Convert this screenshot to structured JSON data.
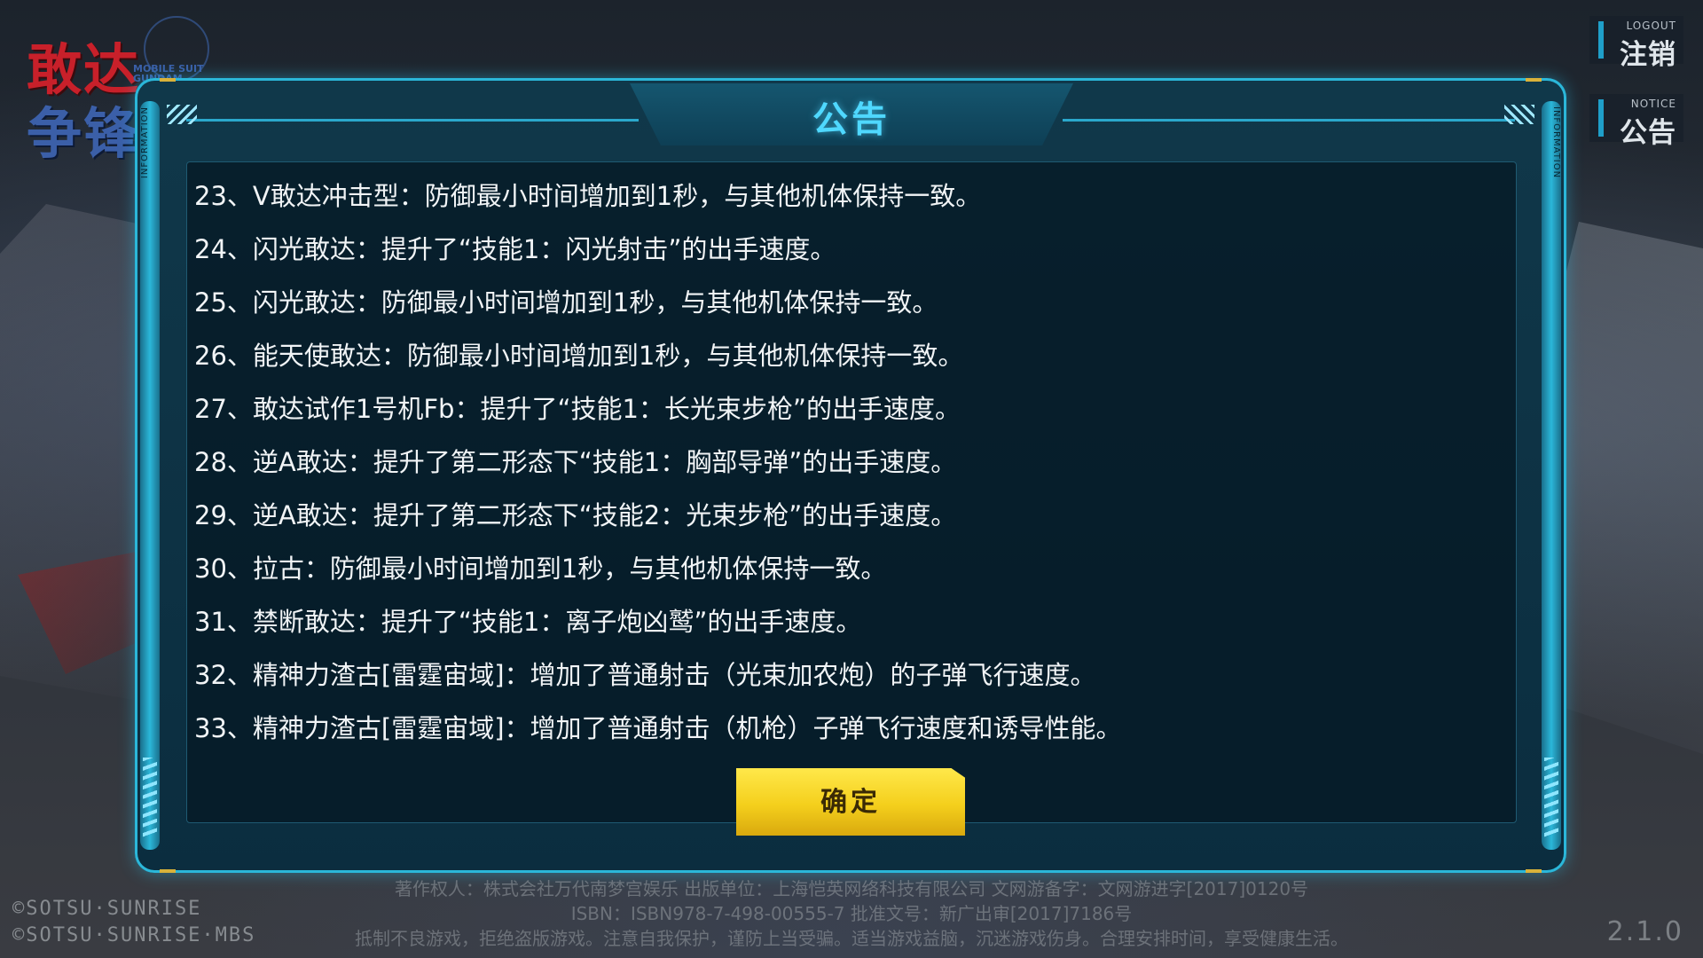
{
  "game_logo": {
    "line1": "敢达",
    "line2": "争锋",
    "subtitle": "MOBILE SUIT GUNDAM"
  },
  "side_nav": {
    "logout": {
      "en": "LOGOUT",
      "zh": "注销"
    },
    "notice": {
      "en": "NOTICE",
      "zh": "公告"
    }
  },
  "panel": {
    "title": "公告",
    "rail_label": "INFORMATION",
    "lines": [
      "23、V敢达冲击型：防御最小时间增加到1秒，与其他机体保持一致。",
      "24、闪光敢达：提升了“技能1：闪光射击”的出手速度。",
      "25、闪光敢达：防御最小时间增加到1秒，与其他机体保持一致。",
      "26、能天使敢达：防御最小时间增加到1秒，与其他机体保持一致。",
      "27、敢达试作1号机Fb：提升了“技能1：长光束步枪”的出手速度。",
      "28、逆A敢达：提升了第二形态下“技能1：胸部导弹”的出手速度。",
      "29、逆A敢达：提升了第二形态下“技能2：光束步枪”的出手速度。",
      "30、拉古：防御最小时间增加到1秒，与其他机体保持一致。",
      "31、禁断敢达：提升了“技能1：离子炮凶鹫”的出手速度。",
      "32、精神力渣古[雷霆宙域]：增加了普通射击（光束加农炮）的子弹飞行速度。",
      "33、精神力渣古[雷霆宙域]：增加了普通射击（机枪）子弹飞行速度和诱导性能。"
    ],
    "confirm_label": "确定"
  },
  "footer": {
    "line1": "著作权人：株式会社万代南梦宫娱乐  出版单位：上海恺英网络科技有限公司  文网游备字：文网游进字[2017]0120号",
    "line2": "ISBN：ISBN978-7-498-00555-7  批准文号：新广出审[2017]7186号",
    "line3": "抵制不良游戏，拒绝盗版游戏。注意自我保护，谨防上当受骗。适当游戏益脑，沉迷游戏伤身。合理安排时间，享受健康生活。",
    "copyright1": "©SOTSU·SUNRISE",
    "copyright2": "©SOTSU·SUNRISE·MBS",
    "version": "2.1.0"
  },
  "colors": {
    "accent_cyan": "#2bb7d9",
    "title_cyan": "#4fd8ff",
    "button_yellow": "#f4cf1c",
    "panel_bg": "#0b2d3f"
  }
}
